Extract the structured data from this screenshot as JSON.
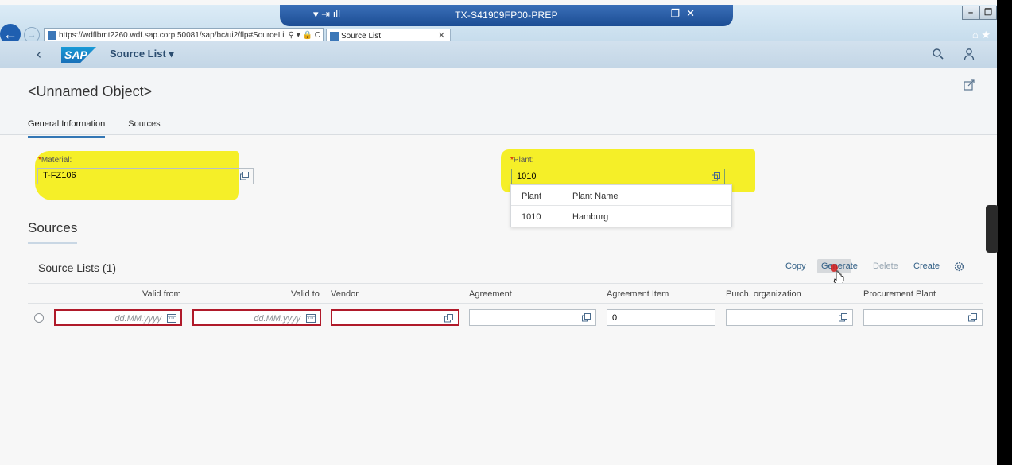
{
  "browser": {
    "url": "https://wdflbmt2260.wdf.sap.corp:50081/sap/bc/ui2/flp#SourceLi",
    "tab_title": "Source List",
    "remote_title": "TX-S41909FP00-PREP"
  },
  "shell": {
    "app_title": "Source List ▾",
    "logo_text": "SAP"
  },
  "object": {
    "title": "<Unnamed Object>",
    "tabs": [
      "General Information",
      "Sources"
    ],
    "active_tab": "General Information"
  },
  "form": {
    "material_label": "Material:",
    "material_value": "T-FZ106",
    "plant_label": "Plant:",
    "plant_value": "1010",
    "required_mark": "*"
  },
  "plant_suggestions": {
    "columns": [
      "Plant",
      "Plant Name"
    ],
    "rows": [
      {
        "plant": "1010",
        "name": "Hamburg"
      }
    ]
  },
  "sources": {
    "section_title": "Sources",
    "list_title": "Source Lists (1)",
    "toolbar": {
      "copy": "Copy",
      "generate": "Generate",
      "delete": "Delete",
      "create": "Create"
    },
    "columns": [
      "Valid from",
      "Valid to",
      "Vendor",
      "Agreement",
      "Agreement Item",
      "Purch. organization",
      "Procurement Plant"
    ],
    "row": {
      "valid_from_placeholder": "dd.MM.yyyy",
      "valid_to_placeholder": "dd.MM.yyyy",
      "agreement_item": "0"
    }
  },
  "colors": {
    "highlight": "#f4ee16",
    "error_border": "#b01a2a",
    "link": "#346187"
  }
}
